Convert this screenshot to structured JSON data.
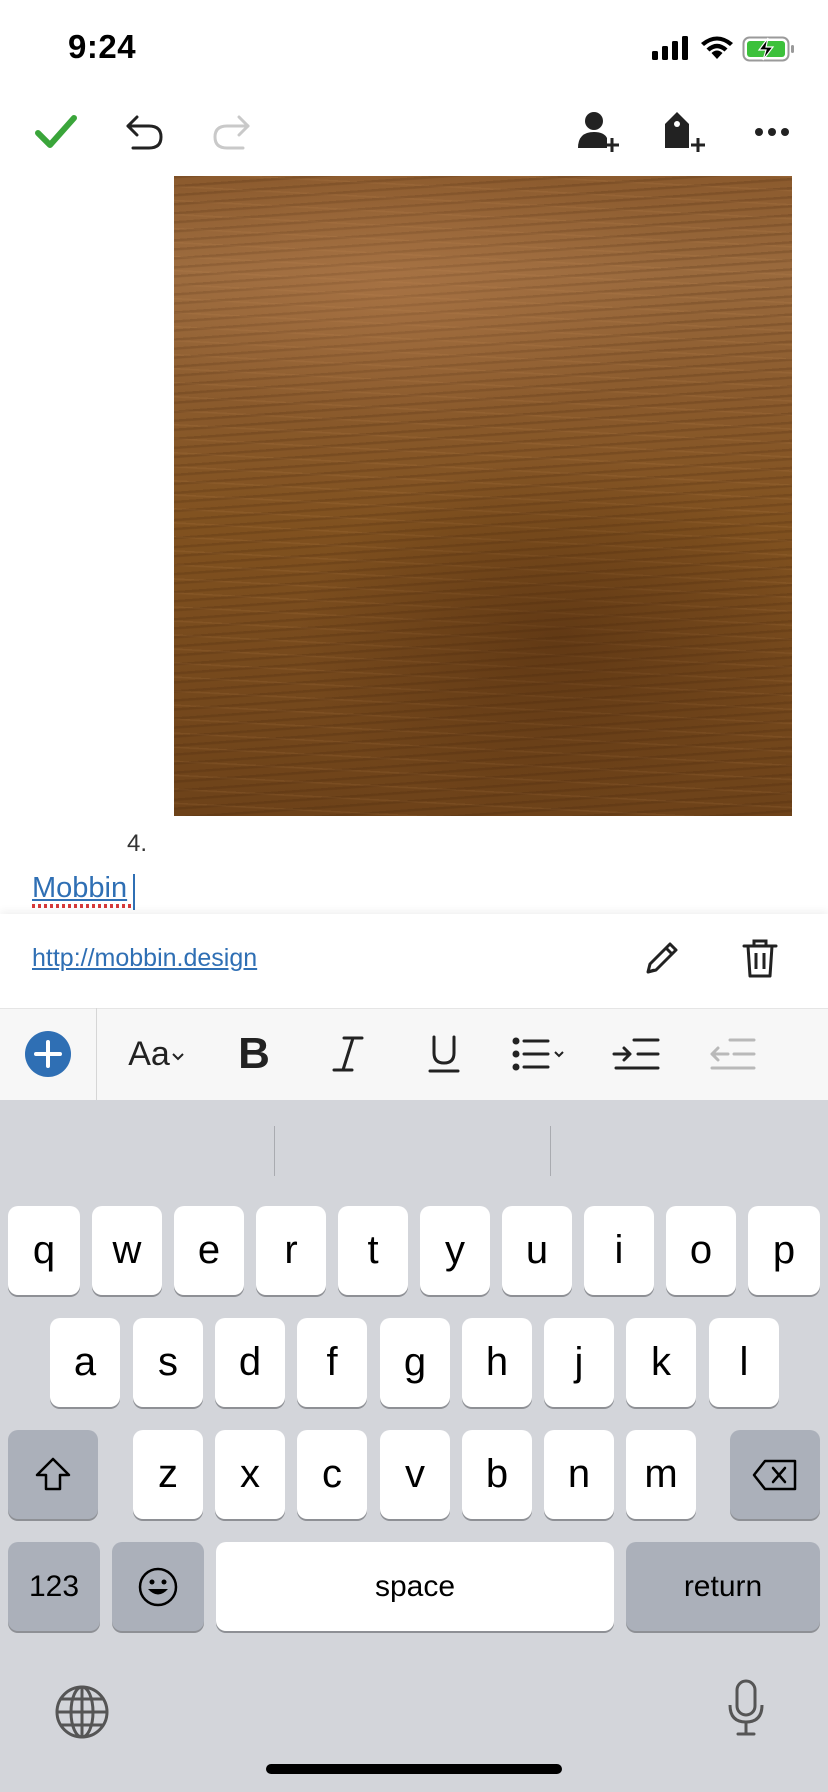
{
  "status_bar": {
    "time": "9:24"
  },
  "note": {
    "list_number": "4.",
    "link_text": "Mobbin"
  },
  "link_bar": {
    "url": "http://mobbin.design"
  },
  "format_bar": {
    "font_label": "Aa",
    "bold": "B"
  },
  "keyboard": {
    "row1": [
      "q",
      "w",
      "e",
      "r",
      "t",
      "y",
      "u",
      "i",
      "o",
      "p"
    ],
    "row2": [
      "a",
      "s",
      "d",
      "f",
      "g",
      "h",
      "j",
      "k",
      "l"
    ],
    "row3": [
      "z",
      "x",
      "c",
      "v",
      "b",
      "n",
      "m"
    ],
    "numbers_key": "123",
    "space_key": "space",
    "return_key": "return"
  },
  "colors": {
    "accent": "#2f6fb4",
    "check": "#3aa53a",
    "battery": "#3cc13b"
  }
}
